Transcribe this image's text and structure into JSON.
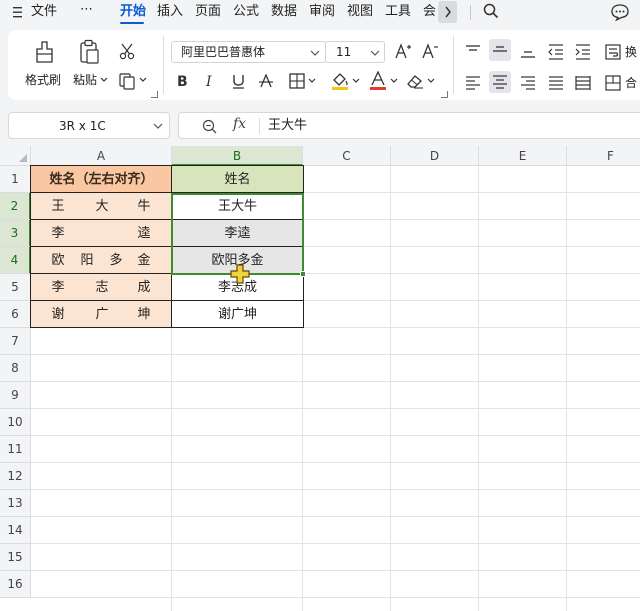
{
  "menu": {
    "file_label": "文件",
    "more_label": "⋯",
    "tabs": [
      "开始",
      "插入",
      "页面",
      "公式",
      "数据",
      "审阅",
      "视图",
      "工具",
      "会"
    ],
    "active_tab": "开始"
  },
  "ribbon": {
    "format_painter_label": "格式刷",
    "paste_label": "粘贴",
    "font_name": "阿里巴巴普惠体",
    "font_size": "11",
    "wrap_label": "换",
    "merge_label": "合",
    "font_color": "#e53935",
    "highlight_color": "#f5c518"
  },
  "formula_bar": {
    "name_box": "3R x 1C",
    "fx_label": "fx",
    "value": "王大牛"
  },
  "grid": {
    "columns": [
      "A",
      "B",
      "C",
      "D",
      "E",
      "F"
    ],
    "rows": [
      "1",
      "2",
      "3",
      "4",
      "5",
      "6",
      "7",
      "8",
      "9",
      "10",
      "11",
      "12",
      "13",
      "14",
      "15",
      "16"
    ],
    "header_a": "姓名（左右对齐）",
    "header_b": "姓名",
    "names_a": [
      [
        "王",
        "大",
        "牛"
      ],
      [
        "李",
        "逵"
      ],
      [
        "欧",
        "阳",
        "多",
        "金"
      ],
      [
        "李",
        "志",
        "成"
      ],
      [
        "谢",
        "广",
        "坤"
      ]
    ],
    "names_b": [
      "王大牛",
      "李逵",
      "欧阳多金",
      "李志成",
      "谢广坤"
    ],
    "selection": "B2:B4",
    "colors": {
      "header_a": "#f9c7a2",
      "data_a": "#fce4d2",
      "header_b": "#d8e4bc",
      "selection": "#3f8b2f"
    }
  }
}
